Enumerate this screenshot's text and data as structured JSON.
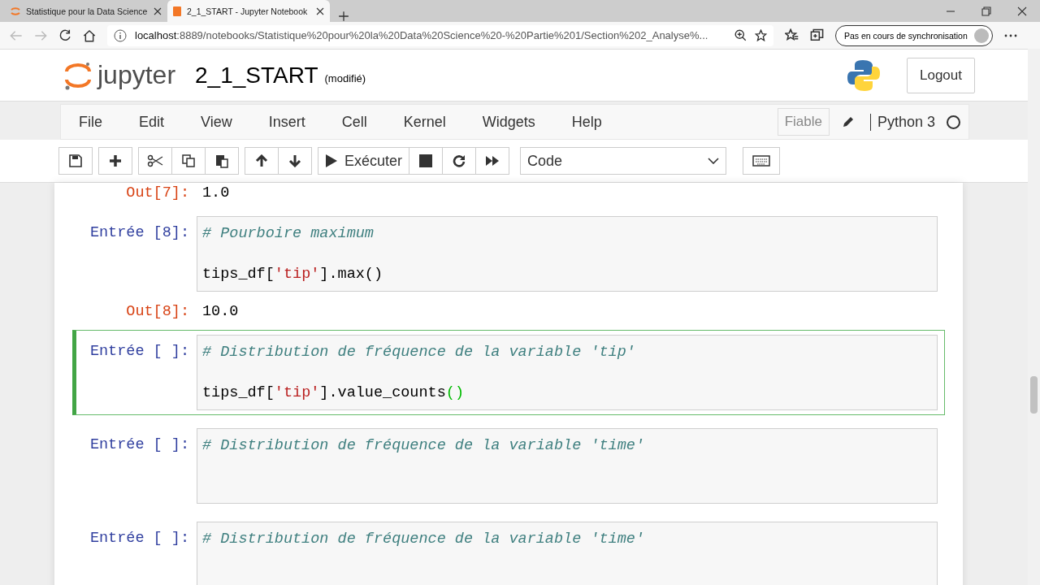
{
  "browser": {
    "tabs": [
      {
        "title": "Statistique pour la Data Science",
        "selected": false
      },
      {
        "title": "2_1_START - Jupyter Notebook",
        "selected": true
      }
    ],
    "url_host": "localhost",
    "url_path": ":8889/notebooks/Statistique%20pour%20la%20Data%20Science%20-%20Partie%201/Section%202_Analyse%...",
    "sync_label": "Pas en cours de synchronisation"
  },
  "header": {
    "logo_text": "jupyter",
    "title": "2_1_START",
    "status": "(modifié)",
    "logout": "Logout"
  },
  "menu": {
    "items": [
      "File",
      "Edit",
      "View",
      "Insert",
      "Cell",
      "Kernel",
      "Widgets",
      "Help"
    ],
    "trusted": "Fiable",
    "kernel": "Python 3"
  },
  "toolbar": {
    "run_label": "Exécuter",
    "cell_type": "Code"
  },
  "cells": [
    {
      "kind": "output",
      "prompt": "Out[7]:",
      "text": "1.0"
    },
    {
      "kind": "input",
      "prompt": "Entrée [8]:",
      "selected": false,
      "lines": [
        [
          {
            "text": "# Pourboire maximum",
            "kind": "comment"
          }
        ],
        [
          {
            "text": "tips_df[",
            "kind": "plain"
          },
          {
            "text": "'tip'",
            "kind": "string"
          },
          {
            "text": "].max()",
            "kind": "plain"
          }
        ]
      ]
    },
    {
      "kind": "output",
      "prompt": "Out[8]:",
      "text": "10.0"
    },
    {
      "kind": "input",
      "prompt": "Entrée [ ]:",
      "selected": true,
      "lines": [
        [
          {
            "text": "# Distribution de fréquence de la variable 'tip'",
            "kind": "comment"
          }
        ],
        [
          {
            "text": "tips_df[",
            "kind": "plain"
          },
          {
            "text": "'tip'",
            "kind": "string"
          },
          {
            "text": "].value_counts",
            "kind": "plain"
          },
          {
            "text": "()",
            "kind": "bracket"
          }
        ]
      ]
    },
    {
      "kind": "input",
      "prompt": "Entrée [ ]:",
      "selected": false,
      "lines": [
        [
          {
            "text": "# Distribution de fréquence de la variable 'time'",
            "kind": "comment"
          }
        ]
      ]
    },
    {
      "kind": "input",
      "prompt": "Entrée [ ]:",
      "selected": false,
      "lines": [
        [
          {
            "text": "# Distribution de fréquence de la variable 'time'",
            "kind": "comment"
          }
        ]
      ]
    }
  ]
}
